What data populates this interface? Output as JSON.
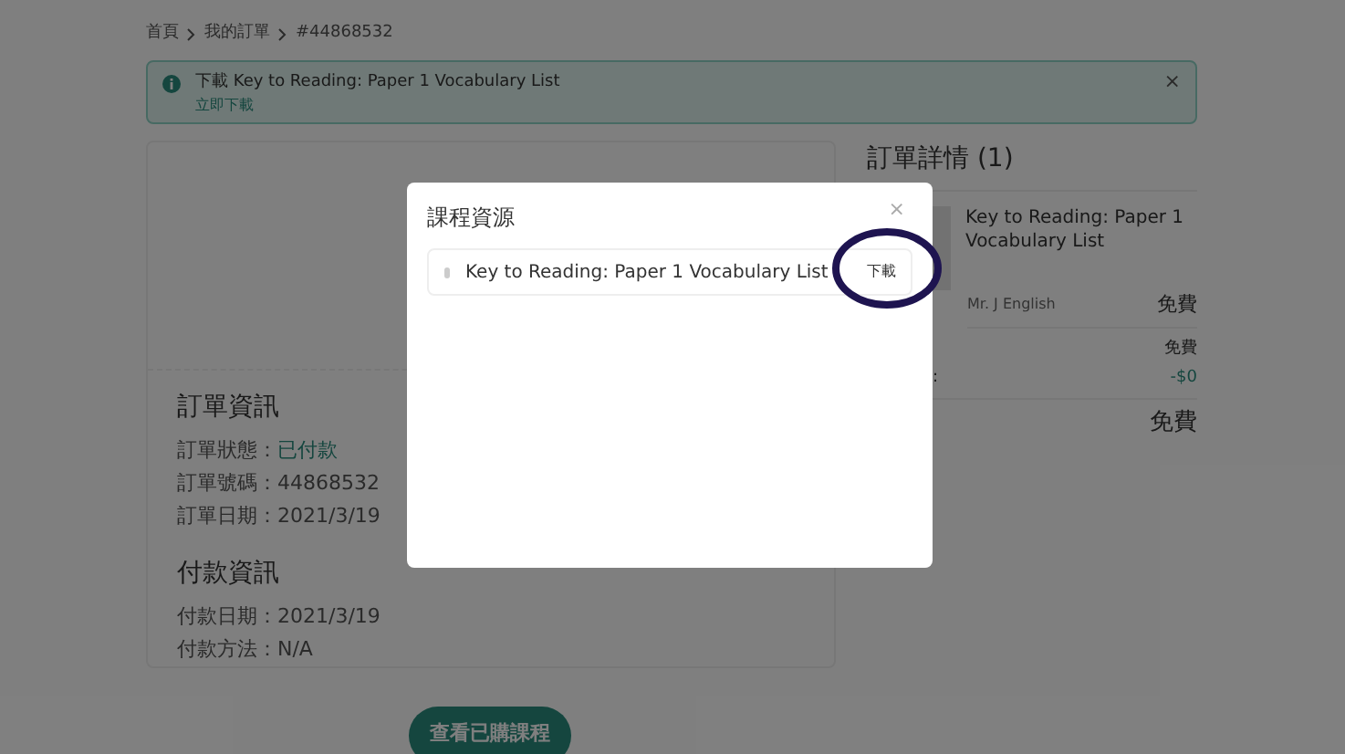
{
  "breadcrumb": [
    "首頁",
    "我的訂單",
    "#44868532"
  ],
  "alert": {
    "message": "下載 Key to Reading: Paper 1 Vocabulary List",
    "link": "立即下載",
    "close": "×"
  },
  "order_info": {
    "title": "訂單資訊",
    "rows": [
      {
        "label": "訂單狀態：",
        "value": "已付款",
        "kind": "status"
      },
      {
        "label": "訂單號碼：",
        "value": "44868532",
        "kind": "plain"
      },
      {
        "label": "訂單日期：",
        "value": "2021/3/19",
        "kind": "plain"
      }
    ]
  },
  "payment_info": {
    "title": "付款資訊",
    "rows": [
      {
        "label": "付款日期：",
        "value": "2021/3/19",
        "kind": "plain"
      },
      {
        "label": "付款方法：",
        "value": "N/A",
        "kind": "plain"
      }
    ]
  },
  "order_details": {
    "title": "訂單詳情 (1)",
    "item": {
      "title": "Key to Reading: Paper 1 Vocabulary List",
      "author": "Mr. J English",
      "price": "免費"
    },
    "subtotal": "免費",
    "discount_label": ":",
    "discount": "-$0",
    "total": "免費"
  },
  "view_courses_button": "查看已購課程",
  "modal": {
    "title": "課程資源",
    "close": "×",
    "files": [
      {
        "name": "Key to Reading: Paper 1 Vocabulary List",
        "action": "下載",
        "highlighted": true
      }
    ]
  }
}
